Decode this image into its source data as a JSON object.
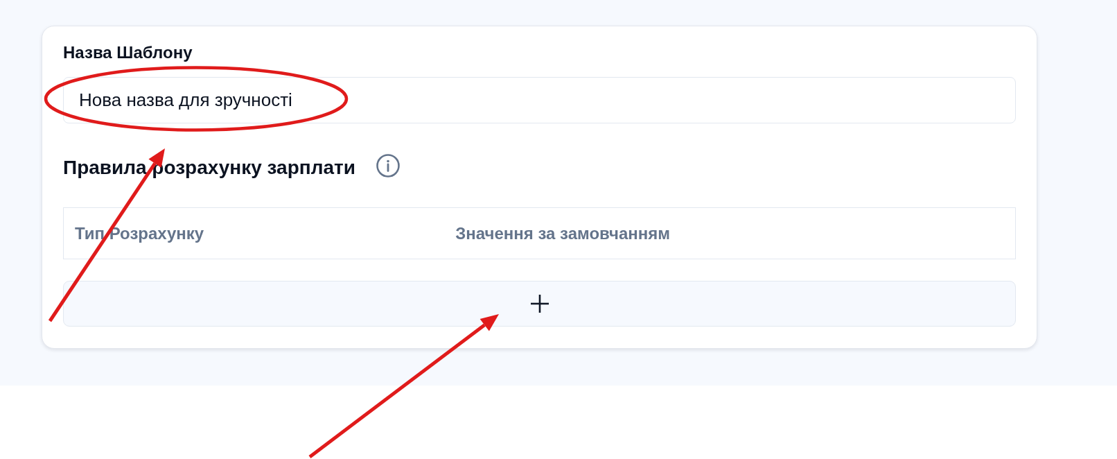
{
  "template_name": {
    "label": "Назва Шаблону",
    "value": "Нова назва для зручності"
  },
  "rules": {
    "title": "Правила розрахунку зарплати",
    "table": {
      "columns": [
        "Тип Розрахунку",
        "Значення за замовчанням"
      ]
    }
  }
}
